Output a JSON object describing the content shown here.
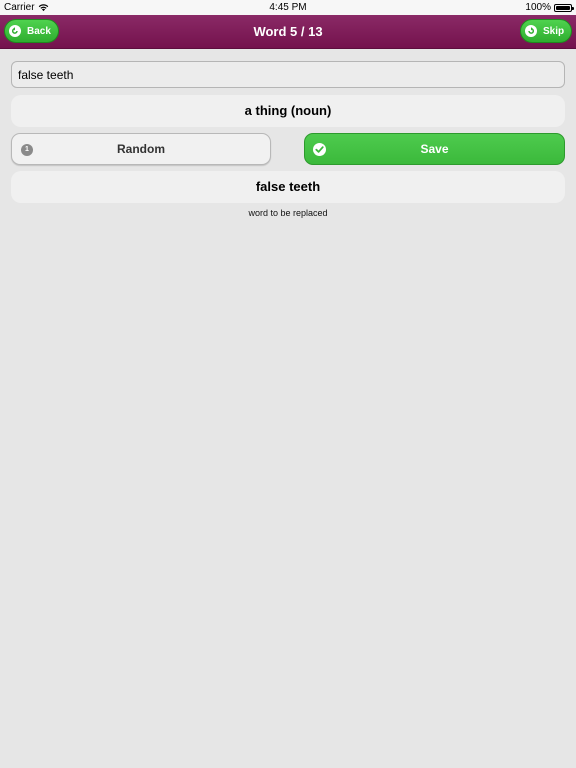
{
  "status_bar": {
    "carrier": "Carrier",
    "time": "4:45 PM",
    "battery": "100%",
    "battery_level": 1.0
  },
  "nav": {
    "title": "Word 5 / 13",
    "back_label": "Back",
    "skip_label": "Skip",
    "bar_color": "#7d1a57",
    "button_color": "#3cc03c"
  },
  "form": {
    "word_value": "false teeth",
    "category": "a thing (noun)",
    "random_label": "Random",
    "random_count": "1",
    "save_label": "Save",
    "replaced_word": "false teeth",
    "replaced_caption": "word to be replaced"
  }
}
